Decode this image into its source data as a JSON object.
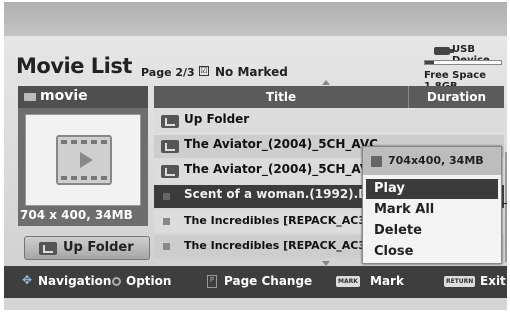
{
  "header": {
    "title": "Movie List",
    "page_info": "Page 2/3",
    "marked_info": "No Marked",
    "device_label": "USB Device",
    "free_space": "Free Space 1.8GB",
    "storage_used_fraction": 0.12
  },
  "folder_panel": {
    "folder_name": "movie",
    "resolution": "704 x 400, 34MB",
    "up_folder_button": "Up Folder"
  },
  "list": {
    "columns": {
      "title": "Title",
      "duration": "Duration"
    },
    "rows": [
      {
        "label": "Up Folder",
        "icon": "up-folder-icon"
      },
      {
        "label": "The Aviator_(2004)_5CH_AVC",
        "icon": "folder-icon"
      },
      {
        "label": "The Aviator_(2004)_5CH_AVC",
        "icon": "folder-icon"
      },
      {
        "label": "Scent of a woman.(1992).DvdRip",
        "icon": "file-icon"
      },
      {
        "label": "The Incredibles [REPACK_AC3_5.0]",
        "icon": "file-icon"
      },
      {
        "label": "The Incredibles [REPACK_AC3_5.0]",
        "icon": "file-icon"
      }
    ]
  },
  "popup_menu": {
    "info": "704x400, 34MB",
    "items": [
      "Play",
      "Mark All",
      "Delete",
      "Close"
    ],
    "active_item": "Play"
  },
  "footer": {
    "navigation": "Navigation",
    "option": "Option",
    "page_change": "Page Change",
    "mark_tag": "MARK",
    "mark": "Mark",
    "return_tag": "RETURN",
    "exit": "Exit"
  }
}
